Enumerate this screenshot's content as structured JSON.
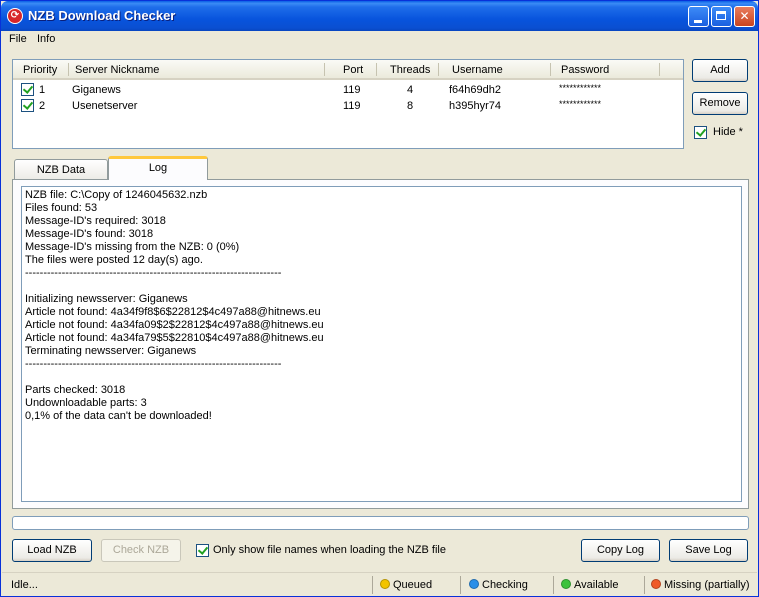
{
  "window": {
    "title": "NZB Download Checker"
  },
  "menu": {
    "file": "File",
    "info": "Info"
  },
  "servers": {
    "columns": [
      "Priority",
      "Server Nickname",
      "Port",
      "Threads",
      "Username",
      "Password"
    ],
    "rows": [
      {
        "checked": true,
        "priority": "1",
        "nickname": "Giganews",
        "port": "119",
        "threads": "4",
        "username": "f64h69dh2",
        "password": "************"
      },
      {
        "checked": true,
        "priority": "2",
        "nickname": "Usenetserver",
        "port": "119",
        "threads": "8",
        "username": "h395hyr74",
        "password": "************"
      }
    ]
  },
  "buttons": {
    "add": "Add",
    "remove": "Remove",
    "hide": "Hide *",
    "load_nzb": "Load NZB",
    "check_nzb": "Check NZB",
    "only_show": "Only show file names when loading the NZB file",
    "copy_log": "Copy Log",
    "save_log": "Save Log"
  },
  "tabs": {
    "nzb_data": "NZB Data",
    "log": "Log"
  },
  "log": [
    "NZB file: C:\\Copy of 1246045632.nzb",
    "Files found: 53",
    "Message-ID's required: 3018",
    "Message-ID's found: 3018",
    "Message-ID's missing from the NZB: 0 (0%)",
    "The files were posted 12 day(s) ago.",
    "----------------------------------------------------------------------",
    "",
    "Initializing newsserver: Giganews",
    "Article not found: 4a34f9f8$6$22812$4c497a88@hitnews.eu",
    "Article not found: 4a34fa09$2$22812$4c497a88@hitnews.eu",
    "Article not found: 4a34fa79$5$22810$4c497a88@hitnews.eu",
    "Terminating newsserver: Giganews",
    "----------------------------------------------------------------------",
    "",
    "Parts checked: 3018",
    "Undownloadable parts: 3",
    "0,1% of the data can't be downloaded!"
  ],
  "status": {
    "idle": "Idle...",
    "queued": "Queued",
    "checking": "Checking",
    "available": "Available",
    "missing": "Missing (partially)",
    "colors": {
      "queued": "#f2c400",
      "checking": "#2a8fe8",
      "available": "#3cc23c",
      "missing": "#f05a28"
    }
  }
}
